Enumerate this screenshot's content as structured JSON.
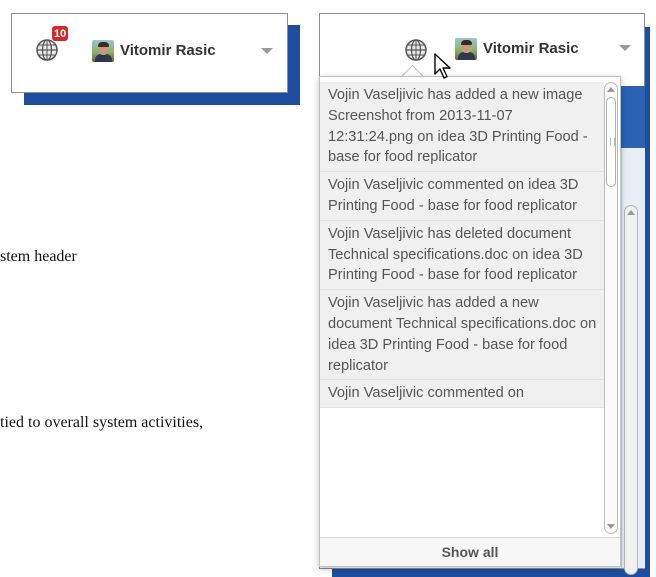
{
  "left_header": {
    "notification_count": "10",
    "user_name": "Vitomir Rasic"
  },
  "right_header": {
    "user_name": "Vitomir Rasic"
  },
  "document": {
    "line1": "stem header",
    "line2": "tied to overall system activities,"
  },
  "notifications": {
    "items": [
      "Vojin Vaseljivic has added a new image Screenshot from 2013-11-07 12:31:24.png on idea 3D Printing Food - base for food replicator",
      "Vojin Vaseljivic commented on idea 3D Printing Food - base for food replicator",
      "Vojin Vaseljivic has deleted document Technical specifications.doc on idea 3D Printing Food - base for food replicator",
      "Vojin Vaseljivic has added a new document Technical specifications.doc on idea 3D Printing Food - base for food replicator",
      "Vojin Vaseljivic commented on"
    ],
    "show_all_label": "Show all"
  },
  "icons": {
    "notifications": "globe-icon",
    "avatar": "user-avatar",
    "menu": "caret-down-icon",
    "pointer": "mouse-cursor-icon"
  },
  "colors": {
    "badge": "#d9262a",
    "shadow": "#1f4ea0"
  }
}
